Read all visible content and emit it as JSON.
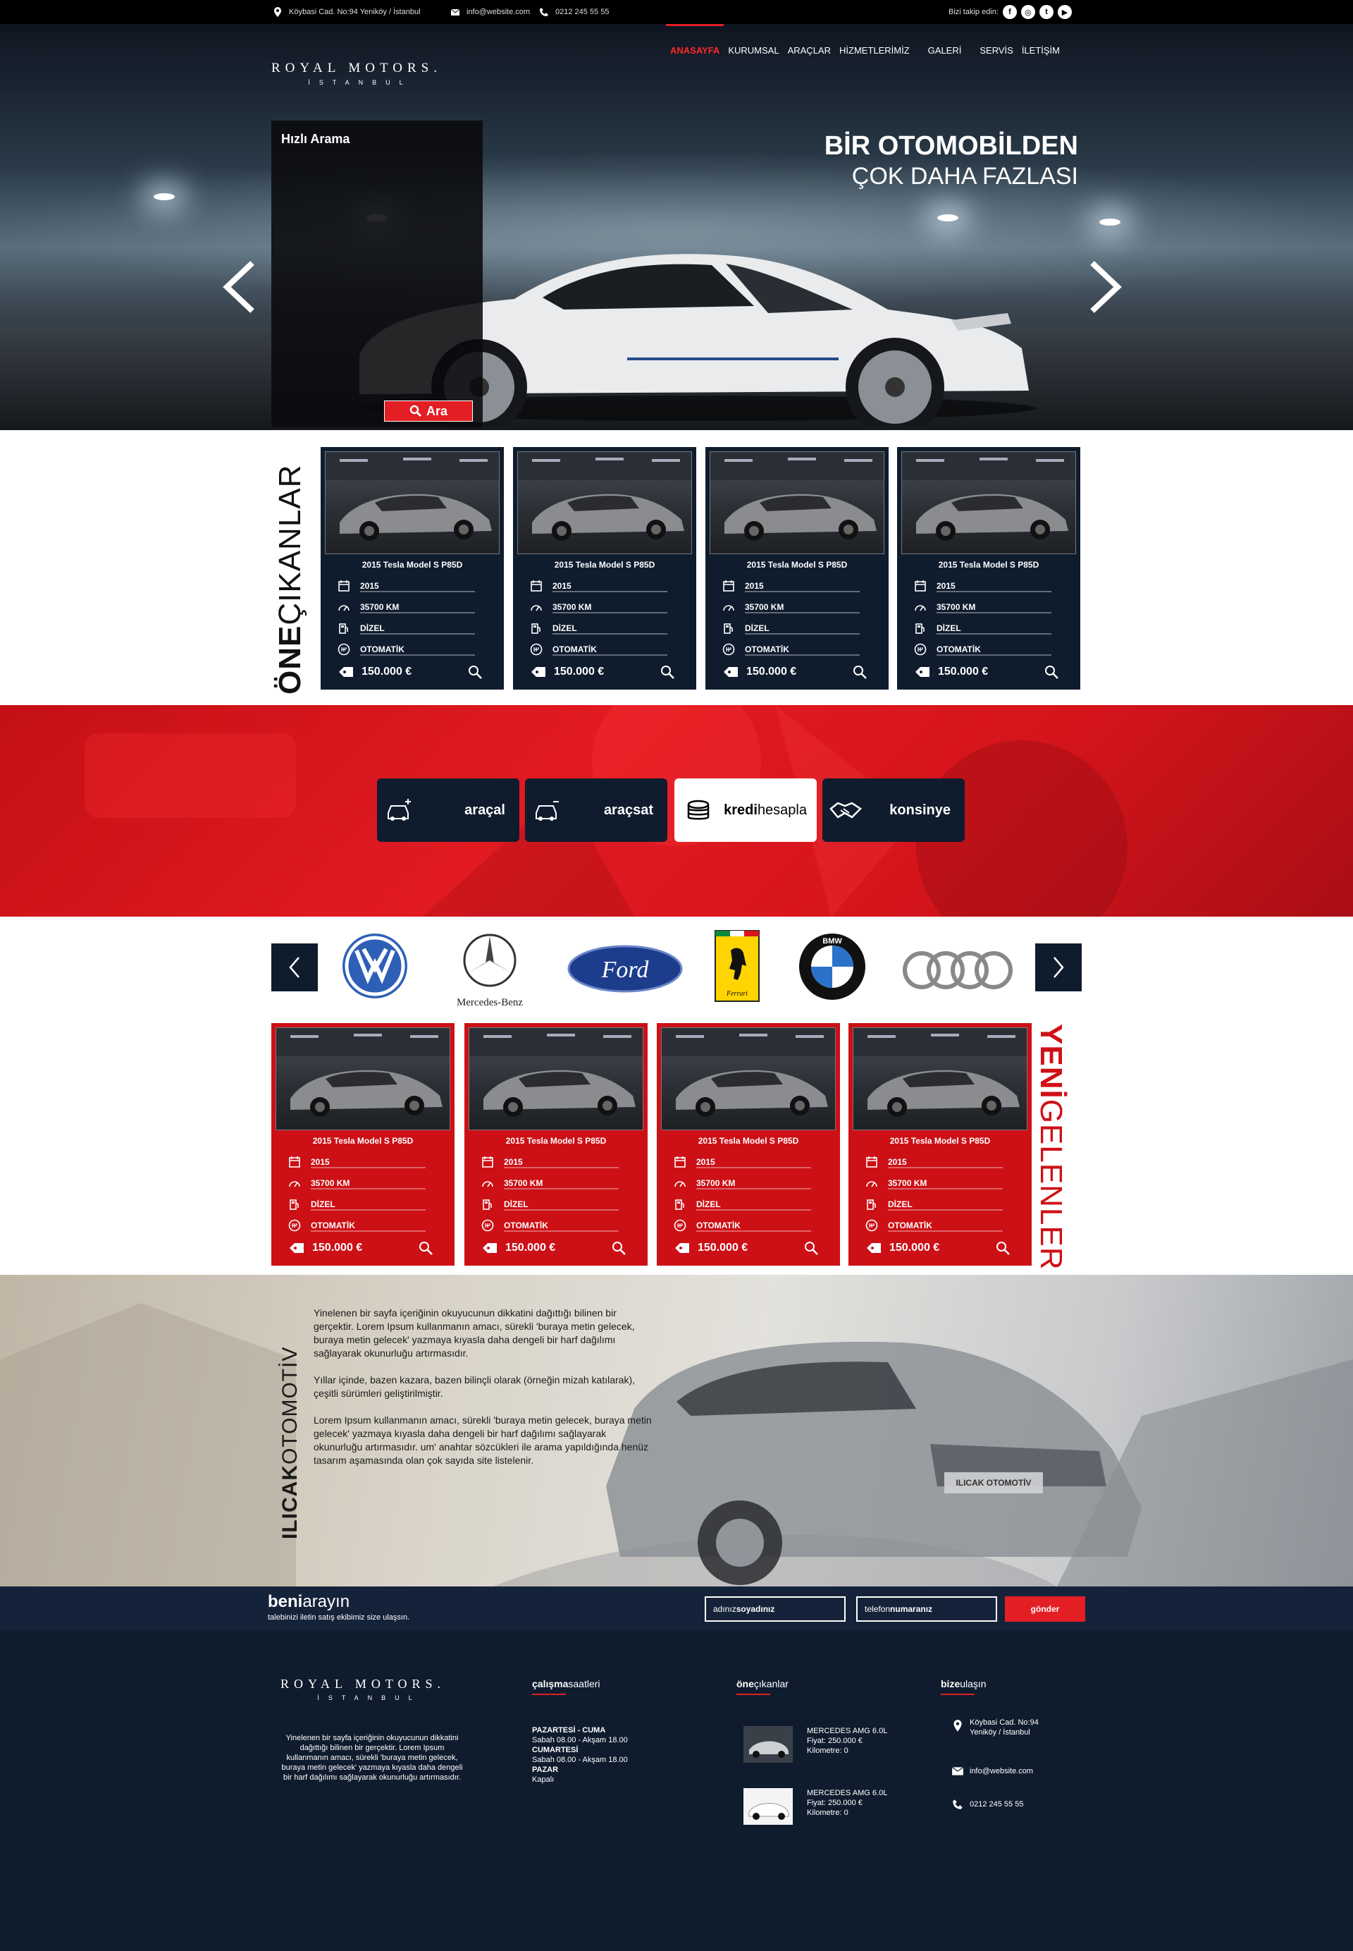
{
  "topbar": {
    "address": "Köybasi Cad. No:94 Yeniköy / İstanbul",
    "email": "info@website.com",
    "phone": "0212 245 55 55",
    "follow_label": "Bizi takip edin:",
    "social": [
      "f",
      "ig",
      "t",
      "yt"
    ]
  },
  "logo": {
    "name": "ROYAL MOTORS.",
    "city": "İSTANBUL"
  },
  "nav": [
    "ANASAYFA",
    "KURUMSAL",
    "ARAÇLAR",
    "HİZMETLERİMİZ",
    "GALERİ",
    "SERVİS",
    "İLETİŞİM"
  ],
  "hero": {
    "quick_search_title": "Hızlı Arama",
    "search_button": "Ara",
    "slogan_line1": "BİR OTOMOBİLDEN",
    "slogan_line2": "ÇOK DAHA FAZLASI"
  },
  "featured": {
    "title_bold": "ÖNE",
    "title_rest": "ÇIKANLAR",
    "cards": [
      {
        "title": "2015 Tesla Model S P85D",
        "year": "2015",
        "km": "35700 KM",
        "fuel": "DİZEL",
        "gear": "OTOMATİK",
        "price": "150.000 €"
      },
      {
        "title": "2015 Tesla Model S P85D",
        "year": "2015",
        "km": "35700 KM",
        "fuel": "DİZEL",
        "gear": "OTOMATİK",
        "price": "150.000 €"
      },
      {
        "title": "2015 Tesla Model S P85D",
        "year": "2015",
        "km": "35700 KM",
        "fuel": "DİZEL",
        "gear": "OTOMATİK",
        "price": "150.000 €"
      },
      {
        "title": "2015 Tesla Model S P85D",
        "year": "2015",
        "km": "35700 KM",
        "fuel": "DİZEL",
        "gear": "OTOMATİK",
        "price": "150.000 €"
      }
    ]
  },
  "actions": [
    {
      "bold": "araçal",
      "rest": ""
    },
    {
      "bold": "araçsat",
      "rest": ""
    },
    {
      "bold": "kredi",
      "rest": "hesapla"
    },
    {
      "bold": "konsinye",
      "rest": ""
    }
  ],
  "brands": [
    "Volkswagen",
    "Mercedes-Benz",
    "Ford",
    "Ferrari",
    "BMW",
    "Audi"
  ],
  "brand_text": {
    "mercedes": "Mercedes-Benz",
    "ford": "Ford",
    "ferrari": "Ferrari",
    "bmw": "BMW"
  },
  "new_arrivals": {
    "title_bold": "YENİ",
    "title_rest": "GELENLER",
    "cards": [
      {
        "title": "2015 Tesla Model S P85D",
        "year": "2015",
        "km": "35700 KM",
        "fuel": "DİZEL",
        "gear": "OTOMATİK",
        "price": "150.000 €"
      },
      {
        "title": "2015 Tesla Model S P85D",
        "year": "2015",
        "km": "35700 KM",
        "fuel": "DİZEL",
        "gear": "OTOMATİK",
        "price": "150.000 €"
      },
      {
        "title": "2015 Tesla Model S P85D",
        "year": "2015",
        "km": "35700 KM",
        "fuel": "DİZEL",
        "gear": "OTOMATİK",
        "price": "150.000 €"
      },
      {
        "title": "2015 Tesla Model S P85D",
        "year": "2015",
        "km": "35700 KM",
        "fuel": "DİZEL",
        "gear": "OTOMATİK",
        "price": "150.000 €"
      }
    ]
  },
  "about": {
    "title_bold": "ILICAK",
    "title_rest": "OTOMOTİV",
    "plate": "ILICAK OTOMOTİV",
    "p1": "Yinelenen bir sayfa içeriğinin okuyucunun dikkatini dağıttığı bilinen bir gerçektir. Lorem Ipsum kullanmanın amacı, sürekli 'buraya metin gelecek, buraya metin gelecek' yazmaya kıyasla daha dengeli bir harf dağılımı sağlayarak okunurluğu artırmasıdır.",
    "p2": "Yıllar içinde, bazen kazara, bazen bilinçli olarak (örneğin mizah katılarak), çeşitli sürümleri geliştirilmiştir.",
    "p3": "Lorem Ipsum kullanmanın amacı, sürekli 'buraya metin gelecek, buraya metin gelecek' yazmaya kıyasla daha dengeli bir harf dağılımı sağlayarak okunurluğu artırmasıdır. um' anahtar sözcükleri ile arama yapıldığında henüz tasarım aşamasında olan çok sayıda site listelenir."
  },
  "callme": {
    "title_bold": "beni",
    "title_rest": "arayın",
    "subtitle": "talebinizi iletin satış ekibimiz size ulaşsın.",
    "name_light": "adınız",
    "name_bold": "soyadınız",
    "phone_light": "telefon",
    "phone_bold": "numaranız",
    "button": "gönder"
  },
  "footer": {
    "logo_name": "ROYAL MOTORS.",
    "logo_city": "İSTANBUL",
    "about": "Yinelenen bir sayfa içeriğinin okuyucunun dikkatini dağıttığı bilinen bir gerçektir. Lorem Ipsum kullanmanın amacı, sürekli 'buraya metin gelecek, buraya metin gelecek' yazmaya kıyasla daha dengeli bir harf dağılımı sağlayarak okunurluğu artırmasıdır.",
    "hours_bold": "çalışma",
    "hours_rest": "saatleri",
    "hours": [
      {
        "day": "PAZARTESİ - CUMA",
        "time": "Sabah 08.00 - Akşam 18.00"
      },
      {
        "day": "CUMARTESİ",
        "time": "Sabah 08.00 - Akşam 18.00"
      },
      {
        "day": "PAZAR",
        "time": "Kapalı"
      }
    ],
    "featured_bold": "öne",
    "featured_rest": "çıkanlar",
    "featured_items": [
      {
        "name": "MERCEDES AMG 6.0L",
        "price": "Fiyat: 250.000 €",
        "km": "Kilometre: 0"
      },
      {
        "name": "MERCEDES AMG 6.0L",
        "price": "Fiyat: 250.000 €",
        "km": "Kilometre: 0"
      }
    ],
    "contact_bold": "bize",
    "contact_rest": "ulaşın",
    "address_line1": "Köybasi Cad. No:94",
    "address_line2": "Yeniköy / İstanbul",
    "email": "info@website.com",
    "phone": "0212 245 55 55"
  },
  "colors": {
    "accent": "#e31e24",
    "navy": "#0f1c2e",
    "black": "#000000"
  }
}
